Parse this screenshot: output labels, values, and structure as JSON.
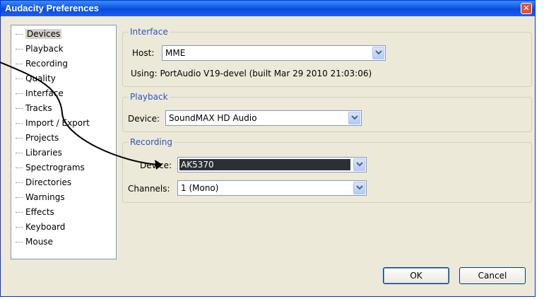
{
  "window": {
    "title": "Audacity Preferences"
  },
  "tree": {
    "items": [
      {
        "label": "Devices",
        "selected": true
      },
      {
        "label": "Playback"
      },
      {
        "label": "Recording"
      },
      {
        "label": "Quality"
      },
      {
        "label": "Interface"
      },
      {
        "label": "Tracks"
      },
      {
        "label": "Import / Export"
      },
      {
        "label": "Projects"
      },
      {
        "label": "Libraries"
      },
      {
        "label": "Spectrograms"
      },
      {
        "label": "Directories"
      },
      {
        "label": "Warnings"
      },
      {
        "label": "Effects"
      },
      {
        "label": "Keyboard"
      },
      {
        "label": "Mouse"
      }
    ]
  },
  "interface": {
    "title": "Interface",
    "host_label": "Host:",
    "host_value": "MME",
    "using_text": "Using: PortAudio V19-devel (built Mar 29 2010 21:03:06)"
  },
  "playback": {
    "title": "Playback",
    "device_label": "Device:",
    "device_value": "SoundMAX HD Audio"
  },
  "recording": {
    "title": "Recording",
    "device_label": "Device:",
    "device_value": "AK5370",
    "channels_label": "Channels:",
    "channels_value": "1 (Mono)"
  },
  "buttons": {
    "ok": "OK",
    "cancel": "Cancel"
  }
}
